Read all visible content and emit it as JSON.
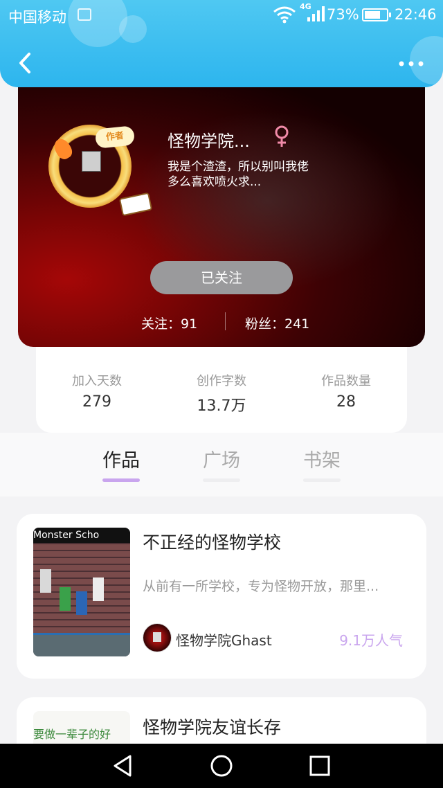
{
  "status_bar": {
    "carrier": "中国移动",
    "network": "4G",
    "battery_percent": "73%",
    "battery_level": 0.73,
    "time": "22:46"
  },
  "header": {
    "back_icon": "back-arrow-icon",
    "more_icon": "more-dots-icon"
  },
  "profile": {
    "avatar_badge": "作者",
    "nickname": "怪物学院...",
    "gender_icon": "female-icon",
    "bio_line1": "我是个渣渣，所以别叫我佬",
    "bio_line2": "多么喜欢喷火求...",
    "follow_button": "已关注",
    "following": "关注：91",
    "followers": "粉丝：241"
  },
  "stats": [
    {
      "label": "加入天数",
      "value": "279"
    },
    {
      "label": "创作字数",
      "value": "13.7万"
    },
    {
      "label": "作品数量",
      "value": "28"
    }
  ],
  "tabs": [
    {
      "label": "作品",
      "active": true
    },
    {
      "label": "广场",
      "active": false
    },
    {
      "label": "书架",
      "active": false
    }
  ],
  "works": [
    {
      "cover_text": "Monster Scho",
      "title": "不正经的怪物学校",
      "description": "从前有一所学校，专为怪物开放，那里...",
      "author": "怪物学院Ghast",
      "popularity": "9.1万人气"
    },
    {
      "cover_text": "要做一辈子的好",
      "title": "怪物学院友谊长存"
    }
  ],
  "nav_bar": {
    "back_icon": "nav-back-triangle-icon",
    "home_icon": "nav-home-circle-icon",
    "recent_icon": "nav-recent-square-icon"
  },
  "colors": {
    "header": "#2db5ee",
    "accent": "#c9a5ee",
    "follow_button": "#9a9a9c",
    "profile_red": "#a50707"
  }
}
